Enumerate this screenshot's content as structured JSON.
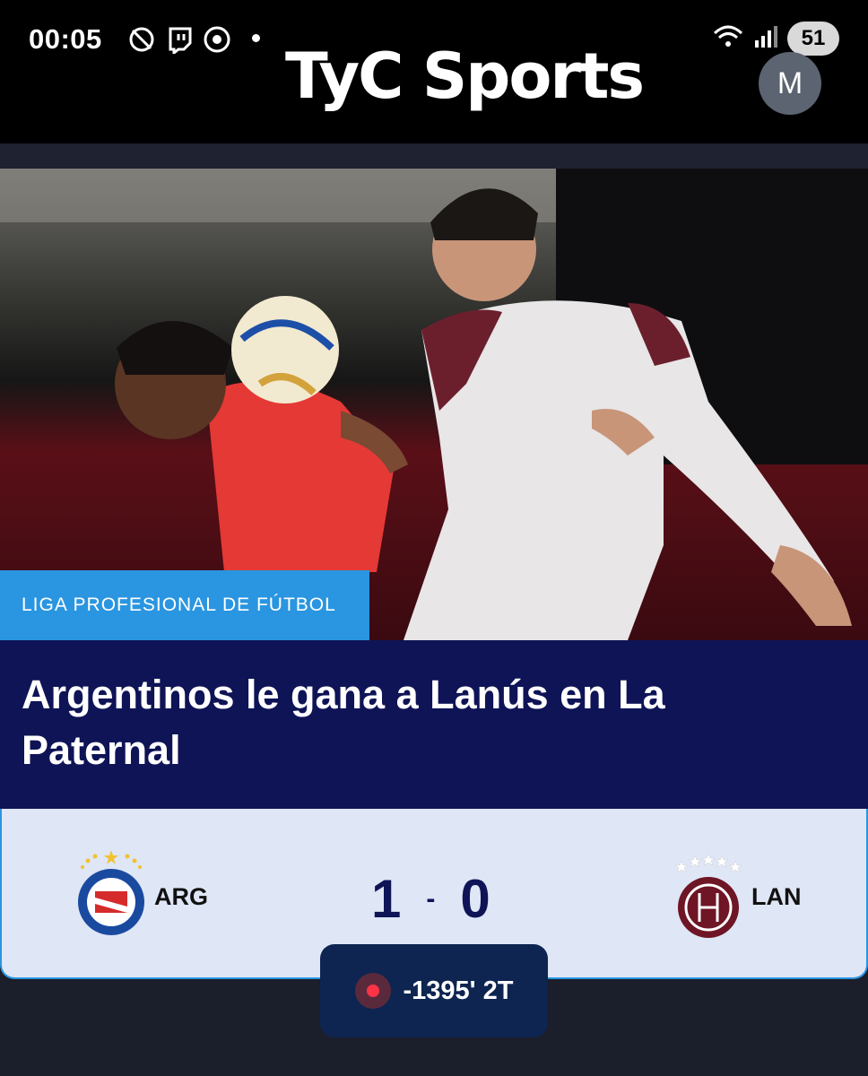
{
  "status_bar": {
    "time": "00:05",
    "battery": "51",
    "icons": [
      "no-signal-icon",
      "twitch-icon",
      "chrome-icon",
      "wifi-icon",
      "cell-signal-icon"
    ]
  },
  "header": {
    "logo": "TyC Sports",
    "avatar_initial": "M"
  },
  "article": {
    "category": "LIGA PROFESIONAL DE FÚTBOL",
    "headline": "Argentinos le gana a Lanús en La Paternal"
  },
  "match": {
    "home_abbr": "ARG",
    "away_abbr": "LAN",
    "home_score": "1",
    "away_score": "0",
    "separator": "-",
    "live_time": "-1395' 2T"
  },
  "colors": {
    "header_bg": "#000000",
    "category_bg": "#2a95e0",
    "headline_bg": "#0e1456",
    "scorecard_bg": "#dfe6f6",
    "live_pill_bg": "#0d2550",
    "live_dot": "#ff3346"
  }
}
